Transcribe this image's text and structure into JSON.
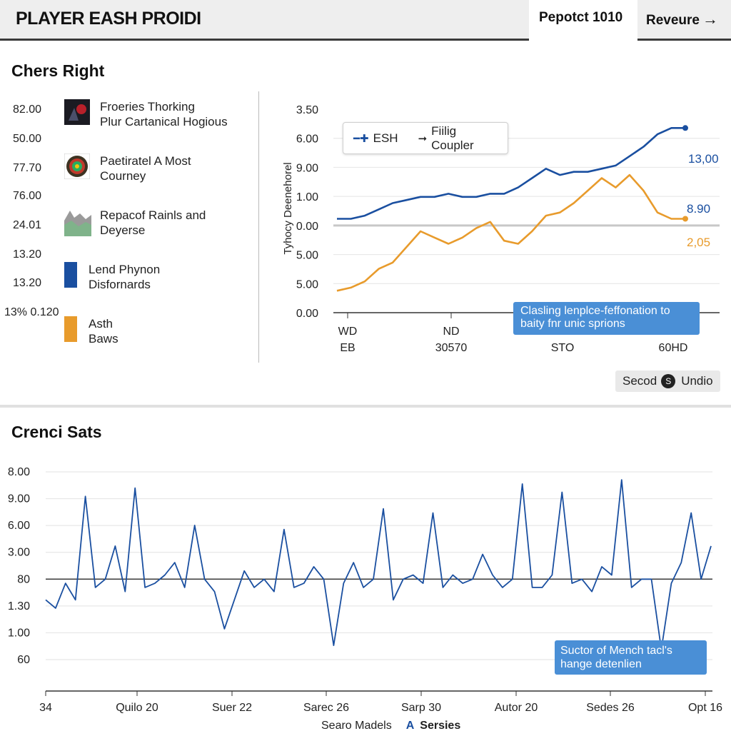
{
  "header": {
    "title": "PLAYER EASH PROIDI",
    "report_tab": "Pepotct 1010",
    "review_label": "Reveure"
  },
  "section1": {
    "title": "Chers Right",
    "left_numbers": [
      "82.00",
      "50.00",
      "77.70",
      "76.00",
      "24.01",
      "13.20",
      "13.20",
      "13% 0.120"
    ],
    "items": [
      {
        "line1": "Froeries Thorking",
        "line2": "Plur Cartanical Hogious",
        "icon": "dark-figure-icon"
      },
      {
        "line1": "Paetiratel A Most",
        "line2": "Courney",
        "icon": "badge-icon"
      },
      {
        "line1": "Repacof Rainls and",
        "line2": "Deyerse",
        "icon": "area-thumbnail-icon"
      },
      {
        "line1": "Lend Phynon",
        "line2": "Disfornards",
        "icon": "blue-square-icon"
      },
      {
        "line1": "Asth",
        "line2": "Baws",
        "icon": "orange-square-icon"
      }
    ]
  },
  "chart1": {
    "ylabel": "Tyhocy Deenehorel",
    "y_ticks": [
      "3.50",
      "6.00",
      "9.00",
      "1.00",
      "0.00",
      "5.00",
      "5.00",
      "0.00"
    ],
    "x_ticks_row1": [
      "WD",
      "ND",
      "",
      ""
    ],
    "x_ticks_row2": [
      "EB",
      "30570",
      "STO",
      "60HD"
    ],
    "legend": [
      "ESH",
      "Fiilig Coupler"
    ],
    "end_labels": [
      "13,00",
      "8.90",
      "2,05"
    ],
    "callout": "Clasling lenplce-feffonation to baity fnr unic sprions",
    "toggle": {
      "left": "Secod",
      "right": "Undio"
    }
  },
  "section2": {
    "title": "Crenci Sats",
    "y_ticks": [
      "8.00",
      "9.00",
      "6.00",
      "3.00",
      "80",
      "1.30",
      "1.00",
      "60"
    ],
    "x_ticks": [
      "34",
      "Quilo 20",
      "Suer 22",
      "Sarec 26",
      "Sarp 30",
      "Autor 20",
      "Sedes 26",
      "Opt 16"
    ],
    "callout": "Suctor of Mench tacl's hange detenlien",
    "footer": {
      "left": "Searo Madels",
      "right": "Sersies"
    }
  },
  "chart_data": [
    {
      "type": "line",
      "title": "",
      "ylabel": "Tyhocy Deenehorel",
      "x": [
        0,
        1,
        2,
        3,
        4,
        5,
        6,
        7,
        8,
        9,
        10,
        11,
        12,
        13,
        14,
        15,
        16,
        17,
        18,
        19,
        20,
        21,
        22,
        23,
        24,
        25
      ],
      "series": [
        {
          "name": "ESH",
          "color": "#1a4fa0",
          "values": [
            3.0,
            3.0,
            3.1,
            3.3,
            3.5,
            3.6,
            3.7,
            3.7,
            3.8,
            3.7,
            3.7,
            3.8,
            3.8,
            4.0,
            4.3,
            4.6,
            4.4,
            4.5,
            4.5,
            4.6,
            4.7,
            5.0,
            5.3,
            5.7,
            5.9,
            5.9
          ]
        },
        {
          "name": "Fiilig Coupler",
          "color": "#e89b2c",
          "values": [
            0.7,
            0.8,
            1.0,
            1.4,
            1.6,
            2.1,
            2.6,
            2.4,
            2.2,
            2.4,
            2.7,
            2.9,
            2.3,
            2.2,
            2.6,
            3.1,
            3.2,
            3.5,
            3.9,
            4.3,
            4.0,
            4.4,
            3.9,
            3.2,
            3.0,
            3.0
          ]
        }
      ]
    },
    {
      "type": "line",
      "title": "",
      "x_ticks": [
        "34",
        "Quilo 20",
        "Suer 22",
        "Sarec 26",
        "Sarp 30",
        "Autor 20",
        "Sedes 26",
        "Opt 16"
      ],
      "series": [
        {
          "name": "Sersies",
          "color": "#1a4fa0",
          "values": [
            2.3,
            2.1,
            2.7,
            2.3,
            4.8,
            2.6,
            2.8,
            3.6,
            2.5,
            5.0,
            2.6,
            2.7,
            2.9,
            3.2,
            2.6,
            4.1,
            2.8,
            2.5,
            1.6,
            2.3,
            3.0,
            2.6,
            2.8,
            2.5,
            4.0,
            2.6,
            2.7,
            3.1,
            2.8,
            1.2,
            2.7,
            3.2,
            2.6,
            2.8,
            4.5,
            2.3,
            2.8,
            2.9,
            2.7,
            4.4,
            2.6,
            2.9,
            2.7,
            2.8,
            3.4,
            2.9,
            2.6,
            2.8,
            5.1,
            2.6,
            2.6,
            2.9,
            4.9,
            2.7,
            2.8,
            2.5,
            3.1,
            2.9,
            5.2,
            2.6,
            2.8,
            2.8,
            1.1,
            2.7,
            3.2,
            4.4,
            2.8,
            3.6
          ]
        }
      ]
    }
  ]
}
